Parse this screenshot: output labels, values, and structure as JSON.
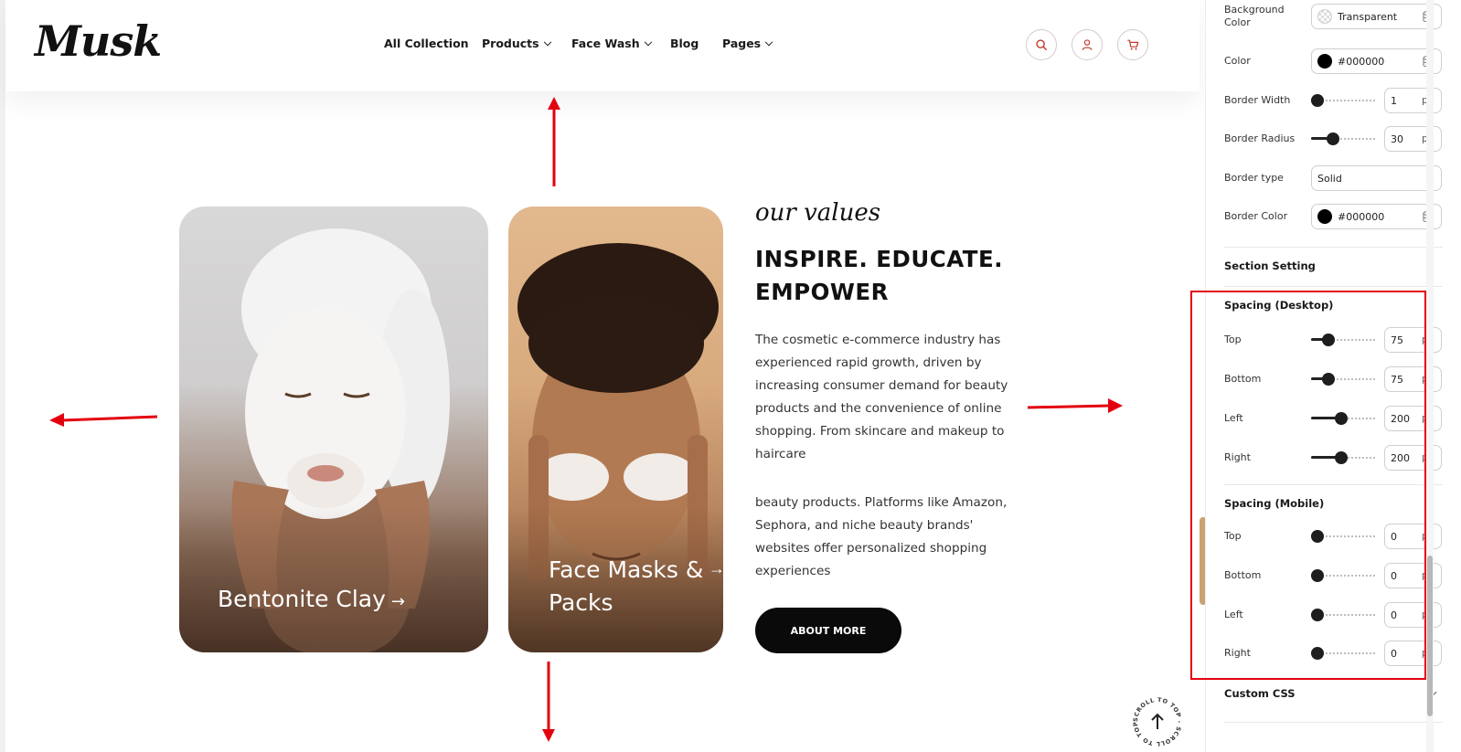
{
  "header": {
    "logo": "Musk",
    "nav": [
      {
        "label": "All Collection",
        "has_dropdown": false
      },
      {
        "label": "Products",
        "has_dropdown": true
      },
      {
        "label": "Face Wash",
        "has_dropdown": true
      },
      {
        "label": "Blog",
        "has_dropdown": false
      },
      {
        "label": "Pages",
        "has_dropdown": true
      }
    ],
    "icons": [
      "search-icon",
      "user-icon",
      "cart-icon"
    ]
  },
  "cards": [
    {
      "title": "Bentonite Clay",
      "arrow": "→"
    },
    {
      "title_line1": "Face Masks &",
      "title_line2": "Packs",
      "arrow": "→"
    }
  ],
  "values": {
    "script_title": "our values",
    "heading_line1": "INSPIRE. EDUCATE.",
    "heading_line2": "EMPOWER",
    "para1": "The cosmetic e-commerce industry has experienced rapid growth, driven by increasing consumer demand for beauty products and the convenience of online shopping. From skincare and makeup to haircare",
    "para2": "beauty products. Platforms like Amazon, Sephora, and niche beauty brands' websites offer personalized shopping experiences",
    "button": "ABOUT MORE"
  },
  "scroll_to_top": {
    "ring_text": "SCROLL TO TOP - SCROLL TO TOP - "
  },
  "panel": {
    "background_color": {
      "label": "Background Color",
      "value": "Transparent"
    },
    "color": {
      "label": "Color",
      "value": "#000000"
    },
    "border_width": {
      "label": "Border Width",
      "value": "1",
      "unit": "px",
      "level": 0
    },
    "border_radius": {
      "label": "Border Radius",
      "value": "30",
      "unit": "px",
      "level": 0.3
    },
    "border_type": {
      "label": "Border type",
      "value": "Solid"
    },
    "border_color": {
      "label": "Border Color",
      "value": "#000000"
    },
    "section_setting": "Section Setting",
    "spacing_desktop": {
      "title": "Spacing (Desktop)",
      "top": {
        "label": "Top",
        "value": "75",
        "unit": "px",
        "level": 0.2
      },
      "bottom": {
        "label": "Bottom",
        "value": "75",
        "unit": "px",
        "level": 0.2
      },
      "left": {
        "label": "Left",
        "value": "200",
        "unit": "px",
        "level": 0.45
      },
      "right": {
        "label": "Right",
        "value": "200",
        "unit": "px",
        "level": 0.45
      }
    },
    "spacing_mobile": {
      "title": "Spacing (Mobile)",
      "top": {
        "label": "Top",
        "value": "0",
        "unit": "px",
        "level": 0
      },
      "bottom": {
        "label": "Bottom",
        "value": "0",
        "unit": "px",
        "level": 0
      },
      "left": {
        "label": "Left",
        "value": "0",
        "unit": "px",
        "level": 0
      },
      "right": {
        "label": "Right",
        "value": "0",
        "unit": "px",
        "level": 0
      }
    },
    "custom_css": "Custom CSS"
  },
  "colors": {
    "accent_red": "#e3000f",
    "brand_tan": "#c9a272",
    "icon_red": "#c0392b"
  }
}
